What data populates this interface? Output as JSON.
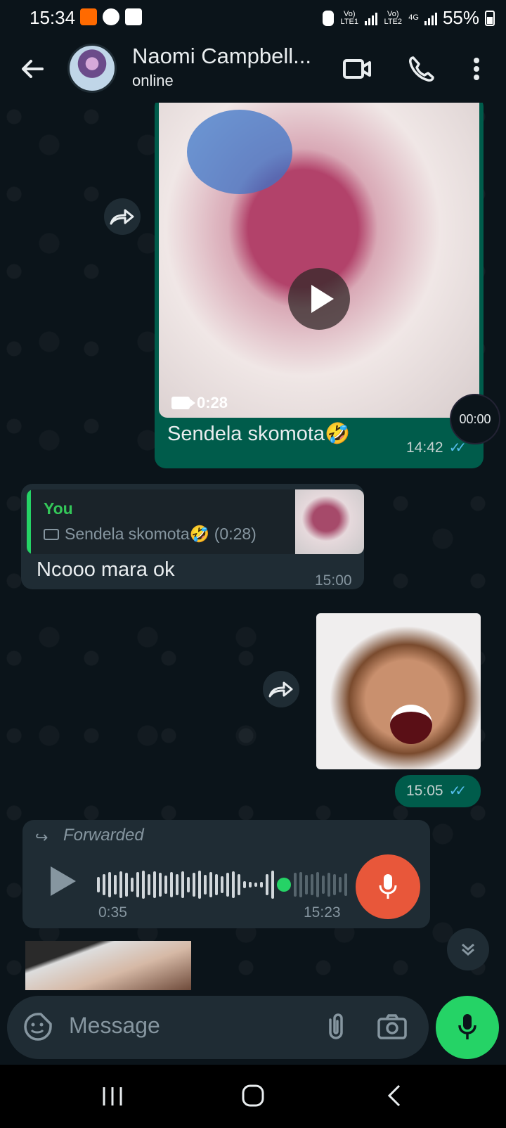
{
  "status_bar": {
    "time": "15:34",
    "sim1_label": "Vo) LTE1",
    "sim2_label": "Vo) LTE2",
    "network": "4G",
    "battery": "55%"
  },
  "header": {
    "contact_name": "Naomi Campbell...",
    "status": "online"
  },
  "messages": {
    "video": {
      "duration": "0:28",
      "caption": "Sendela skomota🤣",
      "time": "14:42",
      "timer": "00:00"
    },
    "reply": {
      "quoted_author": "You",
      "quoted_text": "Sendela skomota🤣 (0:28)",
      "text": "Ncooo mara ok",
      "time": "15:00"
    },
    "photo": {
      "time": "15:05"
    },
    "voice": {
      "forwarded_label": "Forwarded",
      "duration": "0:35",
      "time": "15:23",
      "progress": 0.75
    }
  },
  "input": {
    "placeholder": "Message"
  },
  "colors": {
    "outgoing_bubble": "#005c4b",
    "incoming_bubble": "#1f2c34",
    "accent_green": "#25d366",
    "read_tick": "#53bdeb",
    "record_red": "#e8573a"
  }
}
